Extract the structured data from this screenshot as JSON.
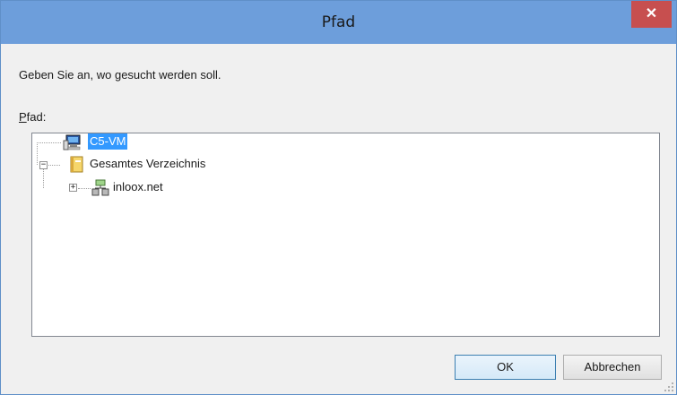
{
  "window": {
    "title": "Pfad"
  },
  "dialog": {
    "instruction": "Geben Sie an, wo gesucht werden soll.",
    "path_label_mnemonic": "P",
    "path_label_rest": "fad:"
  },
  "tree": {
    "nodes": [
      {
        "label": "C5-VM",
        "icon": "computer-icon",
        "selected": true
      },
      {
        "label": "Gesamtes Verzeichnis",
        "icon": "directory-book-icon",
        "expanded": true
      },
      {
        "label": "inloox.net",
        "icon": "domain-icon",
        "expanded": false
      }
    ]
  },
  "buttons": {
    "ok": "OK",
    "cancel": "Abbrechen"
  },
  "colors": {
    "titlebar": "#6d9edb",
    "close": "#c74f4f",
    "selection": "#3399ff"
  }
}
